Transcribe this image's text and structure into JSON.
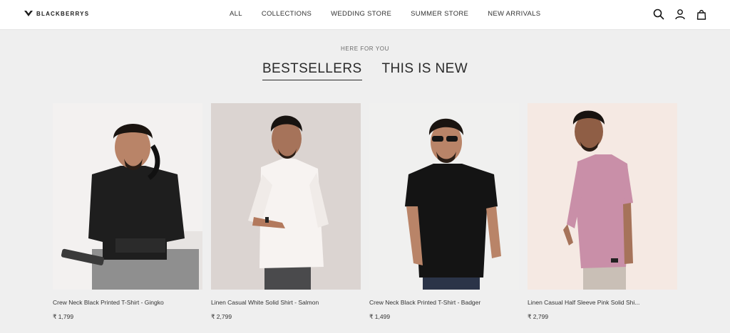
{
  "header": {
    "brand": "BLACKBERRYS",
    "nav": [
      "ALL",
      "COLLECTIONS",
      "WEDDING STORE",
      "SUMMER STORE",
      "NEW ARRIVALS"
    ],
    "icons": [
      "search-icon",
      "account-icon",
      "bag-icon"
    ]
  },
  "section": {
    "eyebrow": "HERE FOR YOU",
    "tabs": [
      "BESTSELLERS",
      "THIS IS NEW"
    ]
  },
  "products": [
    {
      "name": "Crew Neck Black Printed T-Shirt - Gingko",
      "price": "₹ 1,799",
      "shirt_color": "#1e1e1e"
    },
    {
      "name": "Linen Casual White Solid Shirt - Salmon",
      "price": "₹ 2,799",
      "shirt_color": "#f7f3f1"
    },
    {
      "name": "Crew Neck Black Printed T-Shirt - Badger",
      "price": "₹ 1,499",
      "shirt_color": "#141414"
    },
    {
      "name": "Linen Casual Half Sleeve Pink Solid Shi...",
      "price": "₹ 2,799",
      "shirt_color": "#c98fa8"
    }
  ]
}
